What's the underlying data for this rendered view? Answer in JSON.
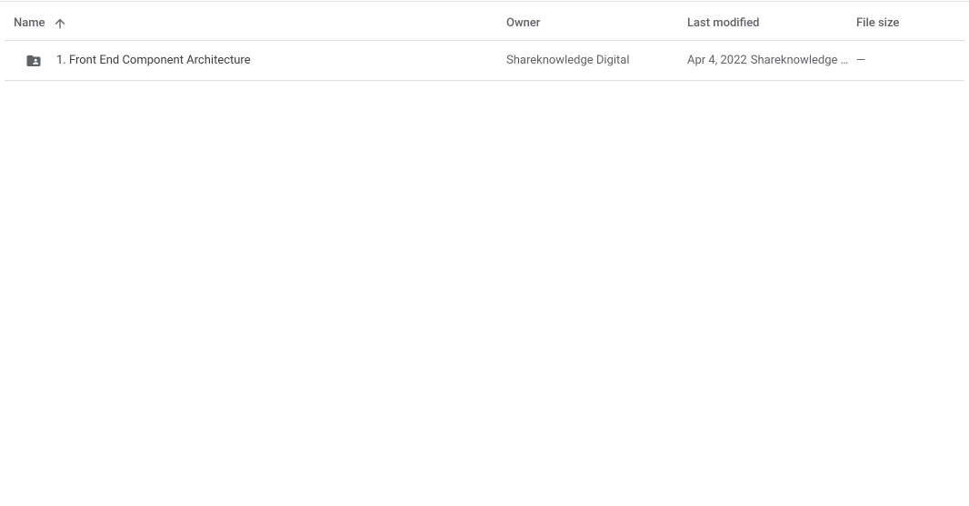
{
  "headers": {
    "name": "Name",
    "owner": "Owner",
    "last_modified": "Last modified",
    "file_size": "File size"
  },
  "rows": [
    {
      "name": "1. Front End Component Architecture",
      "owner": "Shareknowledge Digital",
      "modified_date": "Apr 4, 2022",
      "modified_by": "Shareknowledge D…",
      "size": "—"
    }
  ]
}
